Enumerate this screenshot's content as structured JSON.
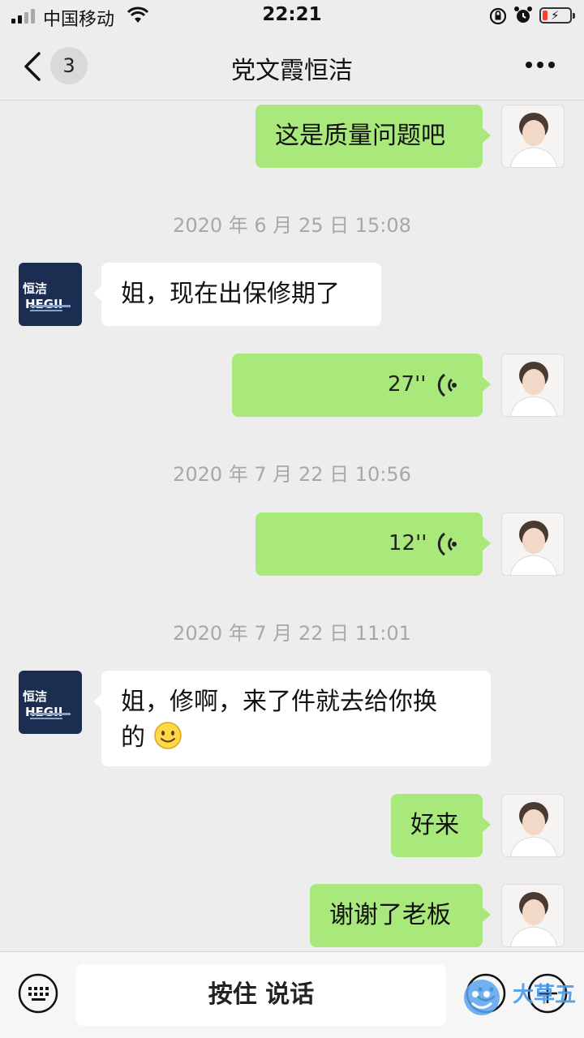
{
  "status_bar": {
    "carrier": "中国移动",
    "time": "22:21",
    "icons": [
      "signal-icon",
      "wifi-icon",
      "orientation-lock-icon",
      "alarm-icon",
      "battery-icon"
    ],
    "battery_color": "#ff3b30"
  },
  "nav": {
    "back_icon": "chevron-left-icon",
    "unread_count": "3",
    "title": "党文霞恒洁",
    "more_icon": "more-icon"
  },
  "messages": [
    {
      "type": "text",
      "sender": "me",
      "text": "这是质量问题吧"
    },
    {
      "type": "time",
      "text": "2020 年 6 月 25 日 15:08"
    },
    {
      "type": "text",
      "sender": "them",
      "text": "姐，现在出保修期了"
    },
    {
      "type": "voice",
      "sender": "me",
      "duration": "27''"
    },
    {
      "type": "time",
      "text": "2020 年 7 月 22 日 10:56"
    },
    {
      "type": "voice",
      "sender": "me",
      "duration": "12''"
    },
    {
      "type": "time",
      "text": "2020 年 7 月 22 日 11:01"
    },
    {
      "type": "text",
      "sender": "them",
      "line1": "姐，修啊，来了件就去给你换",
      "line2": "的",
      "emoji": "smile-emoji"
    },
    {
      "type": "text",
      "sender": "me",
      "text": "好来"
    },
    {
      "type": "text",
      "sender": "me",
      "text": "谢谢了老板"
    }
  ],
  "contact_avatar": {
    "brand_cn": "恒洁",
    "brand_en": "HEGII"
  },
  "input_bar": {
    "talk_label": "按住 说话",
    "keyboard_icon": "keyboard-icon",
    "emoji_icon": "emoji-icon",
    "plus_icon": "plus-icon",
    "watermark": "大草五"
  },
  "colors": {
    "background": "#ededed",
    "bubble_me": "#a9e87a",
    "bubble_them": "#ffffff",
    "timestamp": "#a8a8a8",
    "avatar_them_bg": "#1c2d52"
  }
}
